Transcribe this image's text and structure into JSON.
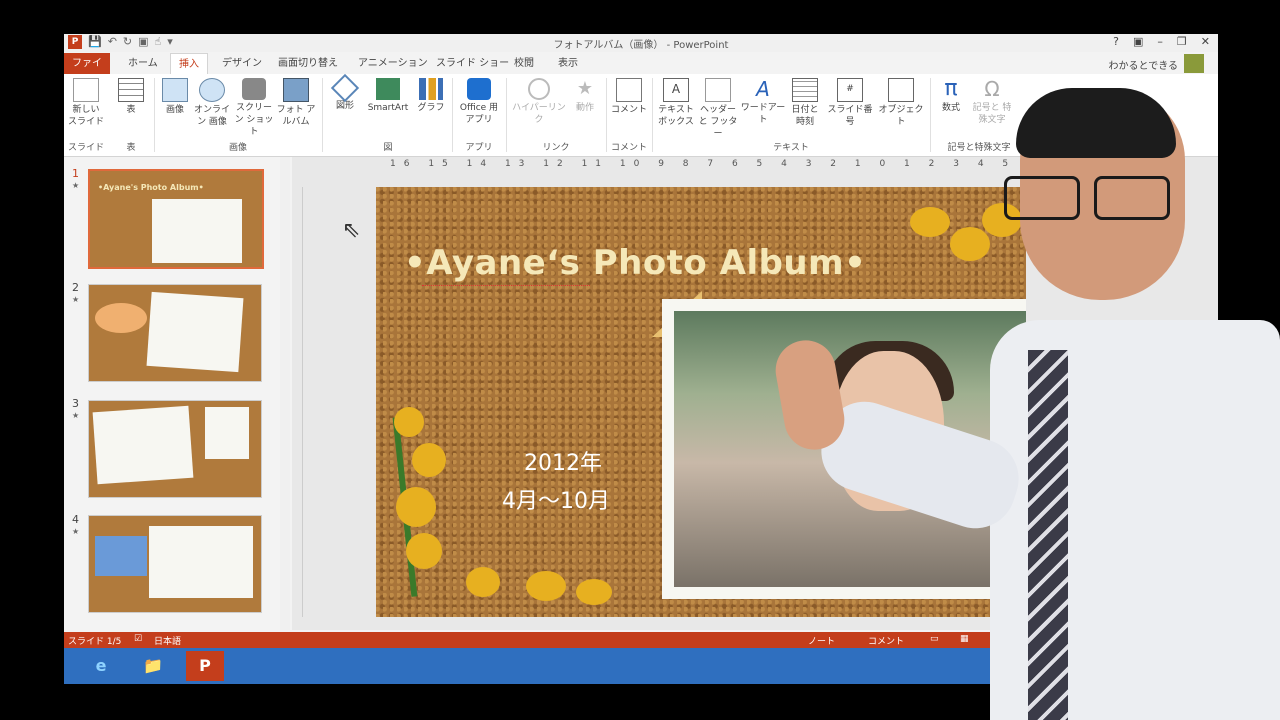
{
  "window": {
    "title": "フォトアルバム（画像） - PowerPoint",
    "buttons": [
      "?",
      "▣",
      "–",
      "❐",
      "✕"
    ],
    "account": "わかるとできる"
  },
  "tabs": [
    "ファイル",
    "ホーム",
    "挿入",
    "デザイン",
    "画面切り替え",
    "アニメーション",
    "スライド ショー",
    "校閲",
    "表示"
  ],
  "active_tab": "挿入",
  "ribbon": {
    "buttons": [
      {
        "label": "新しい スライド",
        "icon": "new-slide-icon"
      },
      {
        "label": "表",
        "icon": "table-icon"
      },
      {
        "label": "画像",
        "icon": "image-icon"
      },
      {
        "label": "オンライン 画像",
        "icon": "online-image-icon"
      },
      {
        "label": "スクリーン ショット",
        "icon": "screenshot-icon"
      },
      {
        "label": "フォト アルバム",
        "icon": "photo-album-icon"
      },
      {
        "label": "図形",
        "icon": "shapes-icon"
      },
      {
        "label": "SmartArt",
        "icon": "smartart-icon"
      },
      {
        "label": "グラフ",
        "icon": "chart-icon"
      },
      {
        "label": "Office 用 アプリ",
        "icon": "office-apps-icon"
      },
      {
        "label": "ハイパーリンク",
        "icon": "hyperlink-icon"
      },
      {
        "label": "動作",
        "icon": "action-icon"
      },
      {
        "label": "コメント",
        "icon": "comment-icon"
      },
      {
        "label": "テキスト ボックス",
        "icon": "textbox-icon"
      },
      {
        "label": "ヘッダーと フッター",
        "icon": "header-footer-icon"
      },
      {
        "label": "ワードアート",
        "icon": "wordart-icon"
      },
      {
        "label": "日付と 時刻",
        "icon": "datetime-icon"
      },
      {
        "label": "スライド番号",
        "icon": "slide-number-icon"
      },
      {
        "label": "オブジェクト",
        "icon": "object-icon"
      },
      {
        "label": "数式",
        "icon": "equation-icon"
      },
      {
        "label": "記号と 特殊文字",
        "icon": "symbol-icon"
      }
    ],
    "groups": [
      "スライド",
      "表",
      "画像",
      "図",
      "アプリ",
      "リンク",
      "コメント",
      "テキスト",
      "記号と特殊文字"
    ]
  },
  "thumbnails": [
    {
      "num": "1",
      "title": "•Ayane's Photo Album•"
    },
    {
      "num": "2"
    },
    {
      "num": "3"
    },
    {
      "num": "4"
    }
  ],
  "ruler": "16 15 14 13 12 11 10 9 8 7 6 5 4 3 2 1 0 1 2 3 4 5 6 7 8 9 10 11",
  "slide": {
    "title": "•Ayane‘s  Photo Album•",
    "year": "2012年",
    "months": "4月～10月"
  },
  "status": {
    "slide": "スライド 1/5",
    "language": "日本語",
    "notes": "ノート",
    "comments": "コメント"
  },
  "taskbar": [
    "e",
    "📁",
    "P"
  ],
  "colors": {
    "accent": "#c43e1c",
    "slide_bg": "#a9753a",
    "taskbar": "#2f6fbf"
  }
}
